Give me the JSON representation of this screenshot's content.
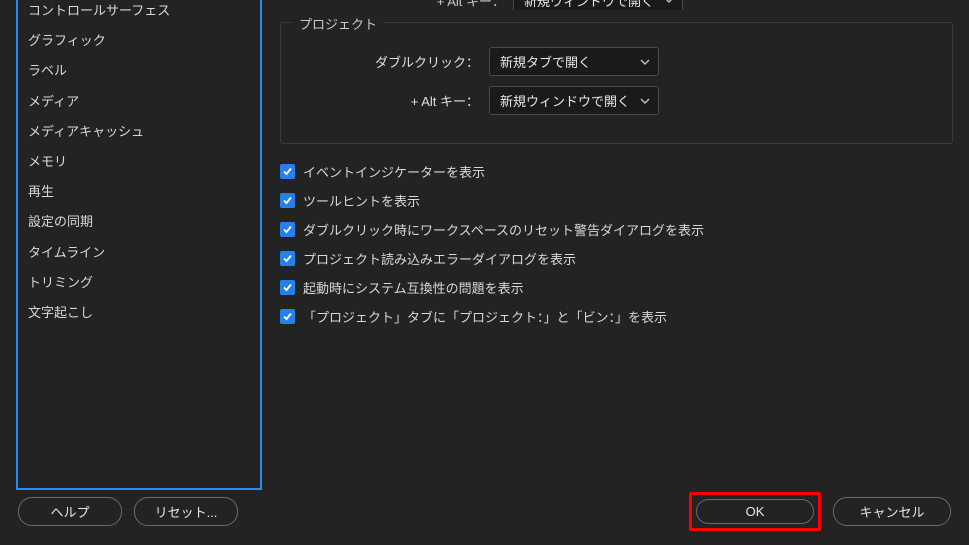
{
  "sidebar": {
    "items": [
      {
        "label": "コントロールサーフェス"
      },
      {
        "label": "グラフィック"
      },
      {
        "label": "ラベル"
      },
      {
        "label": "メディア"
      },
      {
        "label": "メディアキャッシュ"
      },
      {
        "label": "メモリ"
      },
      {
        "label": "再生"
      },
      {
        "label": "設定の同期"
      },
      {
        "label": "タイムライン"
      },
      {
        "label": "トリミング"
      },
      {
        "label": "文字起こし"
      }
    ]
  },
  "partial_row": {
    "label": "+ Alt キー：",
    "value": "新規ウィンドウで開く"
  },
  "fieldset": {
    "legend": "プロジェクト",
    "rows": [
      {
        "label": "ダブルクリック：",
        "value": "新規タブで開く"
      },
      {
        "label": "+ Alt キー：",
        "value": "新規ウィンドウで開く"
      }
    ]
  },
  "checkboxes": [
    {
      "label": "イベントインジケーターを表示",
      "checked": true
    },
    {
      "label": "ツールヒントを表示",
      "checked": true
    },
    {
      "label": "ダブルクリック時にワークスペースのリセット警告ダイアログを表示",
      "checked": true
    },
    {
      "label": "プロジェクト読み込みエラーダイアログを表示",
      "checked": true
    },
    {
      "label": "起動時にシステム互換性の問題を表示",
      "checked": true
    },
    {
      "label": "「プロジェクト」タブに「プロジェクト：」と「ビン：」を表示",
      "checked": true
    }
  ],
  "buttons": {
    "help": "ヘルプ",
    "reset": "リセット...",
    "ok": "OK",
    "cancel": "キャンセル"
  }
}
